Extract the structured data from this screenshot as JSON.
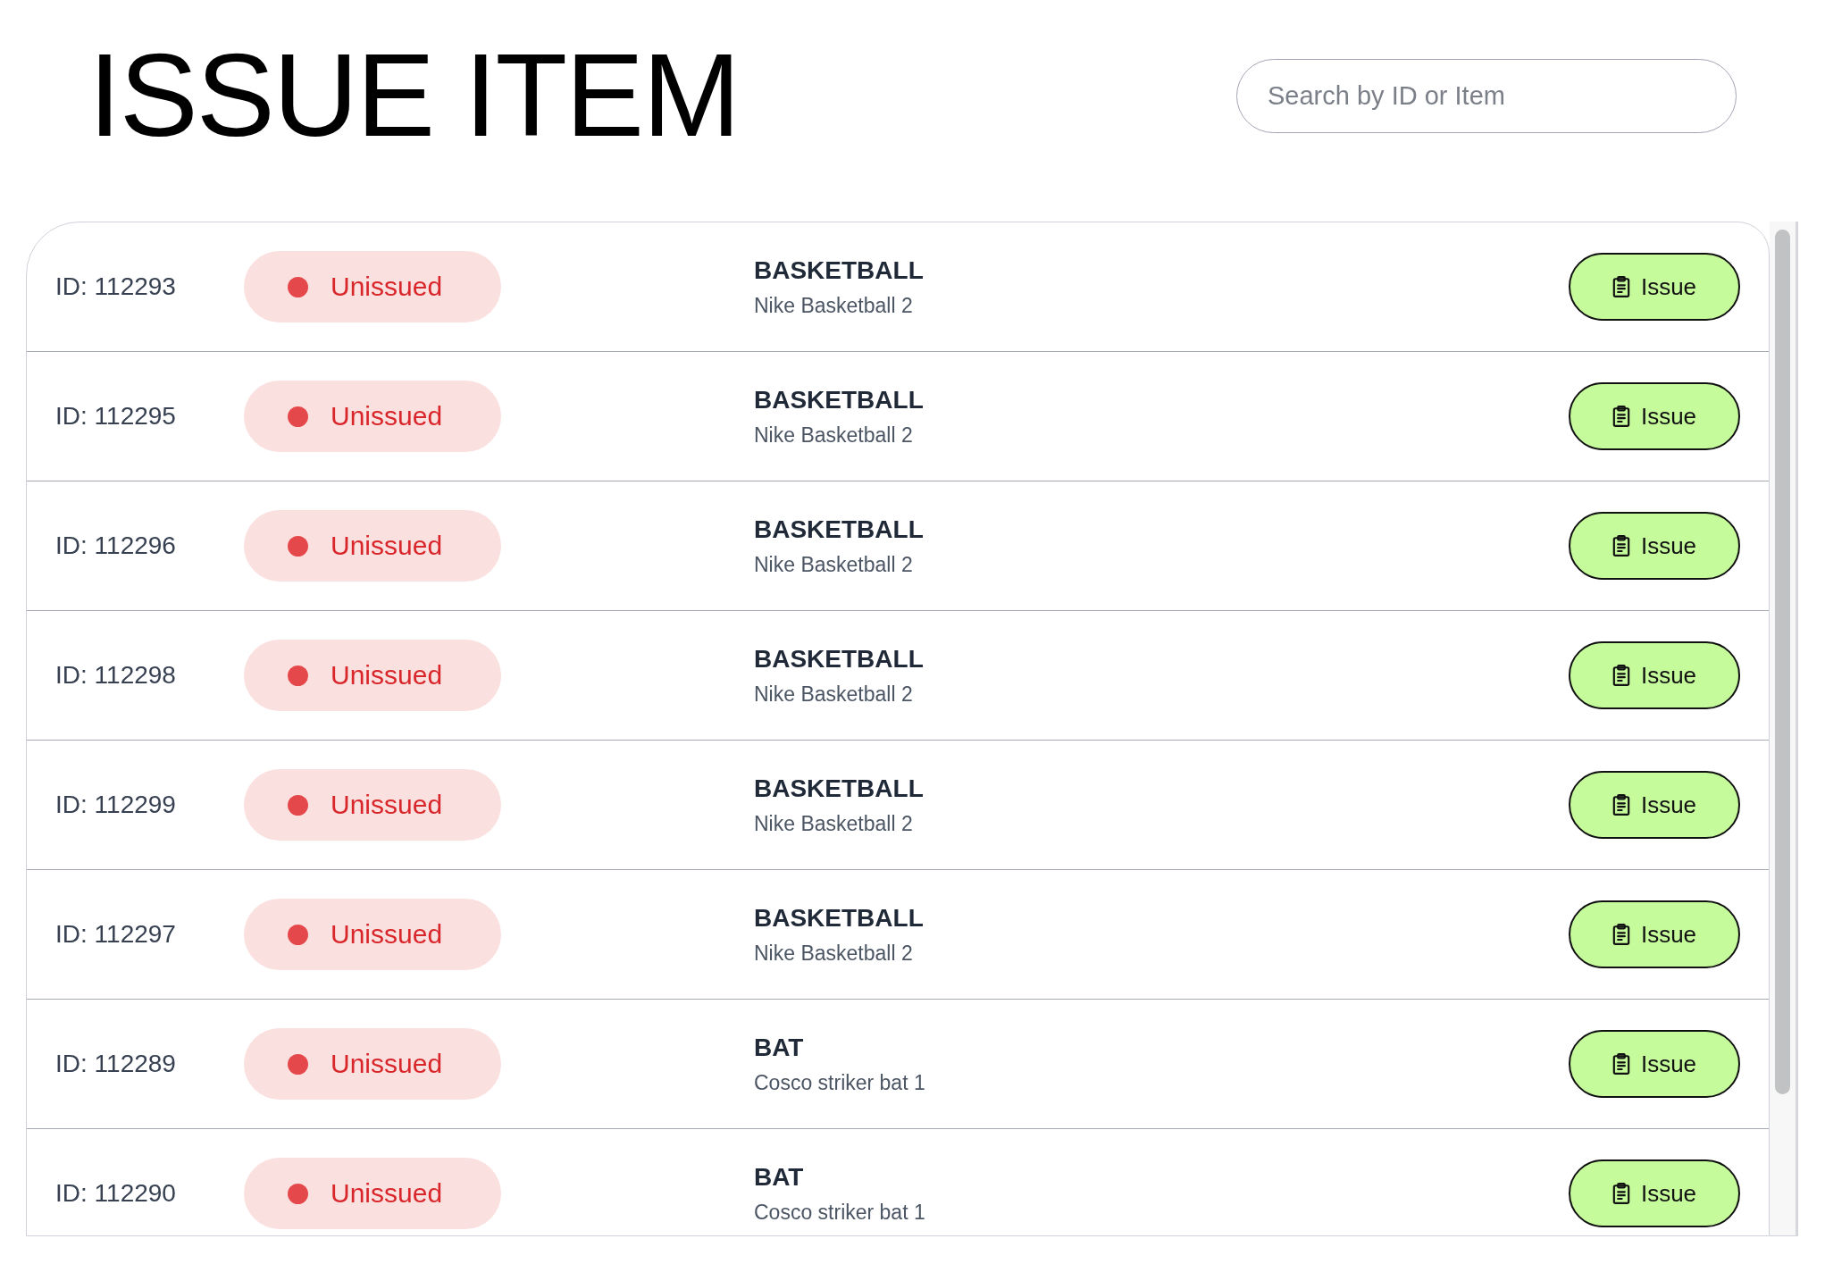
{
  "page": {
    "title": "ISSUE ITEM"
  },
  "search": {
    "placeholder": "Search by ID or Item"
  },
  "items": [
    {
      "id": "ID: 112293",
      "status": "Unissued",
      "color": "#e5484a",
      "name": "BASKETBALL",
      "description": "Nike Basketball 2",
      "action": "Issue"
    },
    {
      "id": "ID: 112295",
      "status": "Unissued",
      "color": "#e5484a",
      "name": "BASKETBALL",
      "description": "Nike Basketball 2",
      "action": "Issue"
    },
    {
      "id": "ID: 112296",
      "status": "Unissued",
      "color": "#e5484a",
      "name": "BASKETBALL",
      "description": "Nike Basketball 2",
      "action": "Issue"
    },
    {
      "id": "ID: 112298",
      "status": "Unissued",
      "color": "#e5484a",
      "name": "BASKETBALL",
      "description": "Nike Basketball 2",
      "action": "Issue"
    },
    {
      "id": "ID: 112299",
      "status": "Unissued",
      "color": "#e5484a",
      "name": "BASKETBALL",
      "description": "Nike Basketball 2",
      "action": "Issue"
    },
    {
      "id": "ID: 112297",
      "status": "Unissued",
      "color": "#e5484a",
      "name": "BASKETBALL",
      "description": "Nike Basketball 2",
      "action": "Issue"
    },
    {
      "id": "ID: 112289",
      "status": "Unissued",
      "color": "#e5484a",
      "name": "BAT",
      "description": "Cosco striker bat 1",
      "action": "Issue"
    },
    {
      "id": "ID: 112290",
      "status": "Unissued",
      "color": "#e5484a",
      "name": "BAT",
      "description": "Cosco striker bat 1",
      "action": "Issue"
    }
  ]
}
